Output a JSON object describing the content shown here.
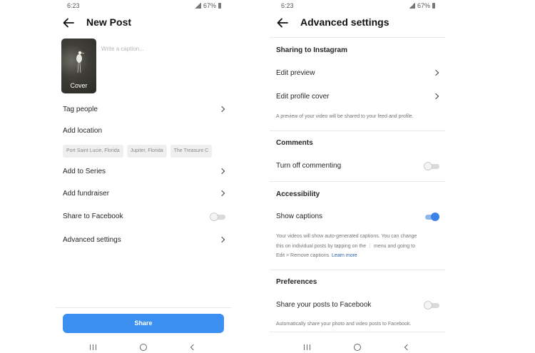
{
  "left": {
    "status_time": "6:23",
    "status_battery": "67%",
    "title": "New Post",
    "cover_label": "Cover",
    "caption_placeholder": "Write a caption...",
    "tag_people": "Tag people",
    "add_location": "Add location",
    "location_chips": [
      "Port Saint Lucie, Florida",
      "Jupiter, Florida",
      "The Treasure C"
    ],
    "add_to_series": "Add to Series",
    "add_fundraiser": "Add fundraiser",
    "share_to_facebook": "Share to Facebook",
    "share_to_facebook_on": false,
    "advanced_settings": "Advanced settings",
    "share_button": "Share"
  },
  "right": {
    "status_time": "6:23",
    "status_battery": "67%",
    "title": "Advanced settings",
    "sharing_header": "Sharing to Instagram",
    "edit_preview": "Edit preview",
    "edit_profile_cover": "Edit profile cover",
    "sharing_note": "A preview of your video will be shared to your feed and profile.",
    "comments_header": "Comments",
    "turn_off_commenting": "Turn off commenting",
    "turn_off_commenting_on": false,
    "accessibility_header": "Accessibility",
    "show_captions": "Show captions",
    "show_captions_on": true,
    "captions_note_1": "Your videos will show auto-generated captions. You can change",
    "captions_note_2a": "this on individual posts by tapping on the",
    "captions_note_2b": "menu and going to",
    "captions_note_3": "Edit > Remove captions.",
    "learn_more": "Learn more",
    "preferences_header": "Preferences",
    "share_posts_to_facebook": "Share your posts to Facebook",
    "share_posts_to_facebook_on": false,
    "facebook_note": "Automatically share your photo and video posts to Facebook."
  },
  "colors": {
    "accent": "#3a8ff0",
    "toggle_on": "#3a82e8",
    "link": "#2a62a8"
  },
  "icons": [
    "back-arrow-icon",
    "chevron-right-icon",
    "toggle-switch",
    "recent-apps-icon",
    "home-icon",
    "nav-back-icon",
    "signal-icon",
    "battery-icon"
  ]
}
